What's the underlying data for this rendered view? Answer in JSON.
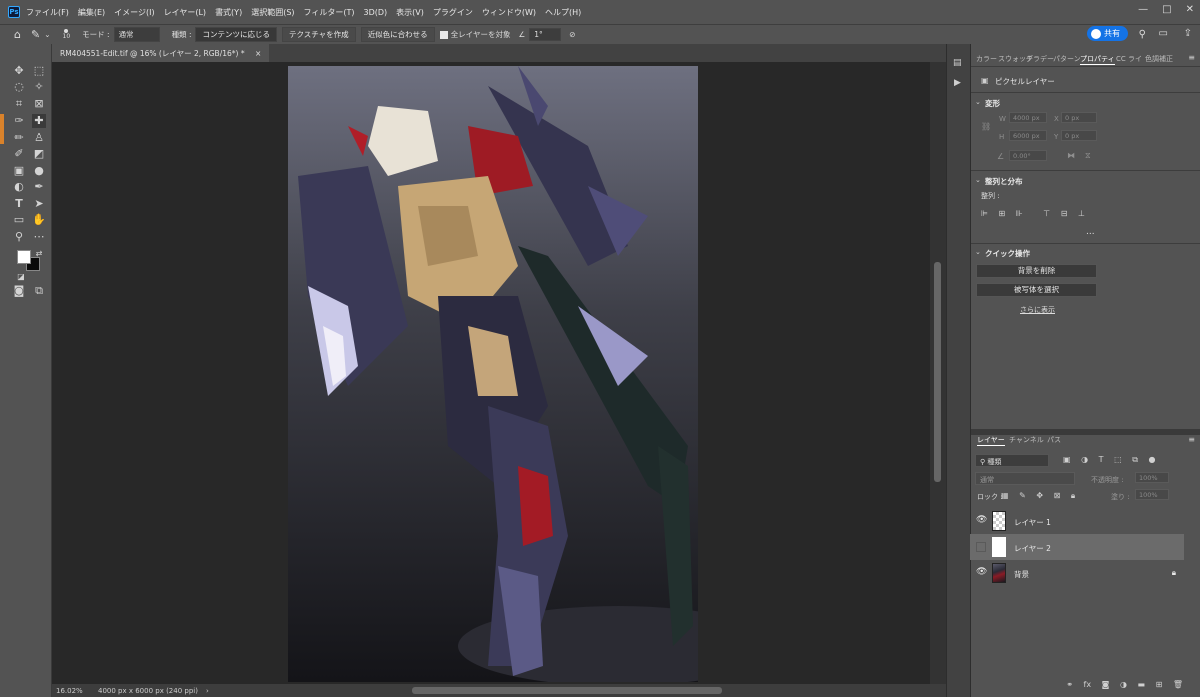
{
  "app": {
    "logo": "Ps"
  },
  "menu": [
    "ファイル(F)",
    "編集(E)",
    "イメージ(I)",
    "レイヤー(L)",
    "書式(Y)",
    "選択範囲(S)",
    "フィルター(T)",
    "3D(D)",
    "表示(V)",
    "プラグイン",
    "ウィンドウ(W)",
    "ヘルプ(H)"
  ],
  "window_controls": {
    "minimize": "—",
    "maximize": "□",
    "close": "✕"
  },
  "options": {
    "brush_size": "10",
    "mode_label": "モード :",
    "mode_value": "通常",
    "type_label": "種類 :",
    "type_btn1": "コンテンツに応じる",
    "type_btn2": "テクスチャを作成",
    "type_btn3": "近似色に合わせる",
    "all_layers": "全レイヤーを対象",
    "angle_value": "1°",
    "share_label": "共有"
  },
  "document": {
    "tab_title": "RM404551-Edit.tif @ 16% (レイヤー 2, RGB/16*) *",
    "zoom": "16.02%",
    "doc_info": "4000 px x 6000 px (240 ppi)"
  },
  "right_panel": {
    "tabs": [
      "カラー",
      "スウォッチ",
      "グラデー",
      "パターン",
      "プロパティ",
      "CC ライ",
      "色調補正"
    ],
    "active_tab": "プロパティ",
    "pixel_layer": "ピクセルレイヤー",
    "transform_title": "変形",
    "transform": {
      "w_label": "W",
      "w": "4000 px",
      "x_label": "X",
      "x": "0 px",
      "h_label": "H",
      "h": "6000 px",
      "y_label": "Y",
      "y": "0 px",
      "angle": "0.00°"
    },
    "align_title": "整列と分布",
    "align_label": "整列 :",
    "more_dots": "...",
    "quick_title": "クイック操作",
    "quick_btn1": "背景を削除",
    "quick_btn2": "被写体を選択",
    "quick_more": "さらに表示"
  },
  "layers_panel": {
    "tabs": [
      "レイヤー",
      "チャンネル",
      "パス"
    ],
    "filter_label": "種類",
    "blend_mode": "通常",
    "opacity_label": "不透明度 :",
    "opacity": "100%",
    "lock_label": "ロック :",
    "fill_label": "塗り :",
    "fill": "100%",
    "layers": [
      {
        "name": "レイヤー 1",
        "visible": true,
        "selected": false,
        "locked": false
      },
      {
        "name": "レイヤー 2",
        "visible": false,
        "selected": true,
        "locked": false
      },
      {
        "name": "背景",
        "visible": true,
        "selected": false,
        "locked": true
      }
    ],
    "bottom_icons": [
      "link-icon",
      "fx-icon",
      "mask-icon",
      "adjustment-icon",
      "folder-icon",
      "new-layer-icon",
      "trash-icon"
    ]
  }
}
